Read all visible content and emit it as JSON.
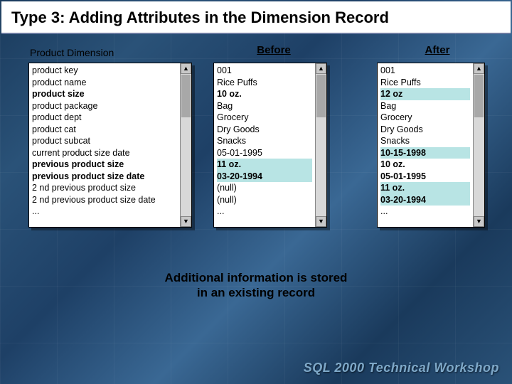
{
  "title": "Type 3: Adding Attributes in the Dimension Record",
  "labels": {
    "dimension": "Product Dimension",
    "before": "Before",
    "after": "After"
  },
  "columns": {
    "fields": [
      {
        "t": "product key"
      },
      {
        "t": "product name"
      },
      {
        "t": "product size",
        "bold": true
      },
      {
        "t": "product package"
      },
      {
        "t": "product dept"
      },
      {
        "t": "product cat"
      },
      {
        "t": "product subcat"
      },
      {
        "t": "current product size date"
      },
      {
        "t": "previous product size",
        "bold": true
      },
      {
        "t": "previous product size date",
        "bold": true
      },
      {
        "t": "2 nd previous product size"
      },
      {
        "t": "2 nd previous product size date"
      },
      {
        "t": "..."
      }
    ],
    "before": [
      {
        "t": "001"
      },
      {
        "t": "Rice Puffs"
      },
      {
        "t": "10 oz.",
        "bold": true
      },
      {
        "t": "Bag"
      },
      {
        "t": "Grocery"
      },
      {
        "t": "Dry Goods"
      },
      {
        "t": "Snacks"
      },
      {
        "t": "05-01-1995"
      },
      {
        "t": "11 oz.",
        "bold": true,
        "hl": true
      },
      {
        "t": "03-20-1994",
        "bold": true,
        "hl": true
      },
      {
        "t": "(null)"
      },
      {
        "t": "(null)"
      },
      {
        "t": "..."
      }
    ],
    "after": [
      {
        "t": "001"
      },
      {
        "t": "Rice Puffs"
      },
      {
        "t": "12 oz",
        "bold": true,
        "hl": true
      },
      {
        "t": "Bag"
      },
      {
        "t": "Grocery"
      },
      {
        "t": "Dry Goods"
      },
      {
        "t": "Snacks"
      },
      {
        "t": "10-15-1998",
        "bold": true,
        "hl": true
      },
      {
        "t": "10 oz.",
        "bold": true
      },
      {
        "t": "05-01-1995",
        "bold": true
      },
      {
        "t": "11 oz.",
        "bold": true,
        "hl": true
      },
      {
        "t": "03-20-1994",
        "bold": true,
        "hl": true
      },
      {
        "t": "..."
      }
    ]
  },
  "caption_line1": "Additional information is stored",
  "caption_line2": "in an existing record",
  "footer": "SQL 2000 Technical Workshop"
}
